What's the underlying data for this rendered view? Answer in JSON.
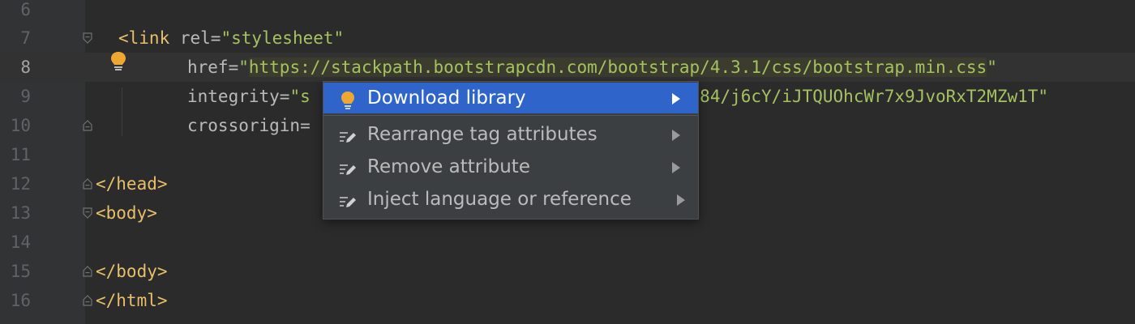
{
  "editor": {
    "lines": [
      {
        "num": "6",
        "parts": []
      },
      {
        "num": "7",
        "parts": [
          {
            "cls": "tag",
            "t": "<link "
          },
          {
            "cls": "attr",
            "t": "rel="
          },
          {
            "cls": "str",
            "t": "\"stylesheet\""
          }
        ]
      },
      {
        "num": "8",
        "parts": [
          {
            "cls": "attr",
            "t": "href="
          },
          {
            "cls": "str",
            "t": "\""
          },
          {
            "cls": "str url-hl",
            "t": "https://stackpath.bootstrapcdn.com/bootstrap/4.3.1/css/bootstrap.min.css"
          },
          {
            "cls": "str",
            "t": "\""
          }
        ]
      },
      {
        "num": "9",
        "parts": [
          {
            "cls": "attr",
            "t": "integrity="
          },
          {
            "cls": "str",
            "t": "\"s"
          },
          {
            "cls": "str",
            "t": "                                  1fQ784/j6cY/iJTQUOhcWr7x9JvoRxT2MZw1T\""
          }
        ]
      },
      {
        "num": "10",
        "parts": [
          {
            "cls": "attr",
            "t": "crossorigin="
          }
        ]
      },
      {
        "num": "11",
        "parts": []
      },
      {
        "num": "12",
        "parts": [
          {
            "cls": "tag",
            "t": "</head>"
          }
        ]
      },
      {
        "num": "13",
        "parts": [
          {
            "cls": "tag",
            "t": "<body>"
          }
        ]
      },
      {
        "num": "14",
        "parts": []
      },
      {
        "num": "15",
        "parts": [
          {
            "cls": "tag",
            "t": "</body>"
          }
        ]
      },
      {
        "num": "16",
        "parts": [
          {
            "cls": "tag",
            "t": "</html>"
          }
        ]
      }
    ]
  },
  "popup": {
    "items": [
      {
        "label": "Download library",
        "icon": "lightbulb-icon"
      },
      {
        "label": "Rearrange tag attributes",
        "icon": "edit-intention-icon"
      },
      {
        "label": "Remove attribute",
        "icon": "edit-intention-icon"
      },
      {
        "label": "Inject language or reference",
        "icon": "edit-intention-icon"
      }
    ]
  },
  "colors": {
    "background": "#2b2b2b",
    "gutter": "#313335",
    "tag": "#e8bf6a",
    "string": "#a5c261",
    "attribute": "#bababa",
    "selection": "#2f65ca",
    "bulb": "#f0a732"
  }
}
